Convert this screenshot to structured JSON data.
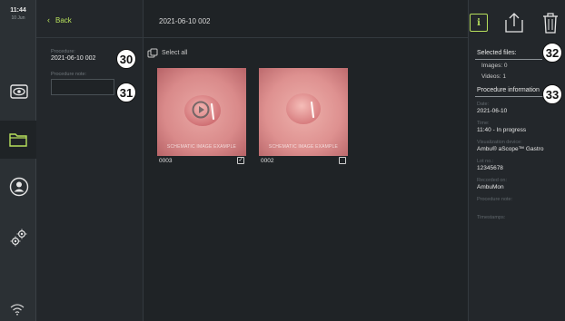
{
  "status": {
    "time": "11:44",
    "date": "10 Jun"
  },
  "header": {
    "back_label": "Back",
    "title": "2021-06-10 002"
  },
  "left_panel": {
    "procedure_label": "Procedure:",
    "procedure_value": "2021-06-10 002",
    "note_label": "Procedure note:"
  },
  "grid": {
    "select_all_label": "Select all",
    "items": [
      {
        "label": "0003",
        "checked": true,
        "watermark": "SCHEMATIC IMAGE EXAMPLE",
        "is_video": true
      },
      {
        "label": "0002",
        "checked": false,
        "watermark": "SCHEMATIC IMAGE EXAMPLE",
        "is_video": false
      }
    ]
  },
  "right_panel": {
    "selected_title": "Selected files:",
    "images": "Images: 0",
    "videos": "Videos: 1",
    "proc_info_title": "Procedure information",
    "fields": [
      {
        "label": "Date:",
        "value": "2021-06-10"
      },
      {
        "label": "Time:",
        "value": "11:40 - In progress"
      },
      {
        "label": "Visualization device:",
        "value": "Ambu® aScope™ Gastro"
      },
      {
        "label": "Lot no.:",
        "value": "12345678"
      },
      {
        "label": "Recorded on:",
        "value": "AmbuMon"
      },
      {
        "label": "Procedure note:",
        "value": ""
      },
      {
        "label": "Timestamps:",
        "value": ""
      }
    ]
  },
  "callouts": [
    "30",
    "31",
    "32",
    "33"
  ],
  "icons": {
    "rail": [
      "eye-icon",
      "folder-icon",
      "user-icon",
      "settings-icon",
      "wifi-icon"
    ],
    "toolbar": [
      "info-icon",
      "export-icon",
      "trash-icon"
    ]
  },
  "colors": {
    "accent": "#b7e05c",
    "background": "#1f2326",
    "panel": "#23272b"
  }
}
